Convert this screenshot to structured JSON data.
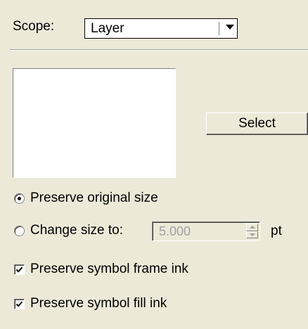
{
  "scope": {
    "label": "Scope:",
    "selected": "Layer"
  },
  "select_button": "Select",
  "size_options": {
    "preserve_original": "Preserve original size",
    "change_size": "Change size to:",
    "selected": "preserve_original",
    "size_value": "5.000",
    "unit": "pt"
  },
  "checkboxes": {
    "frame_ink": {
      "label": "Preserve symbol frame ink",
      "checked": true
    },
    "fill_ink": {
      "label": "Preserve symbol fill ink",
      "checked": true
    }
  },
  "icons": [
    "dropdown-arrow-icon",
    "spinner-up-icon",
    "spinner-down-icon",
    "checkmark-icon"
  ],
  "colors": {
    "background": "#ece9d8",
    "field": "#ffffff",
    "disabled_text": "#a0a0a0"
  }
}
